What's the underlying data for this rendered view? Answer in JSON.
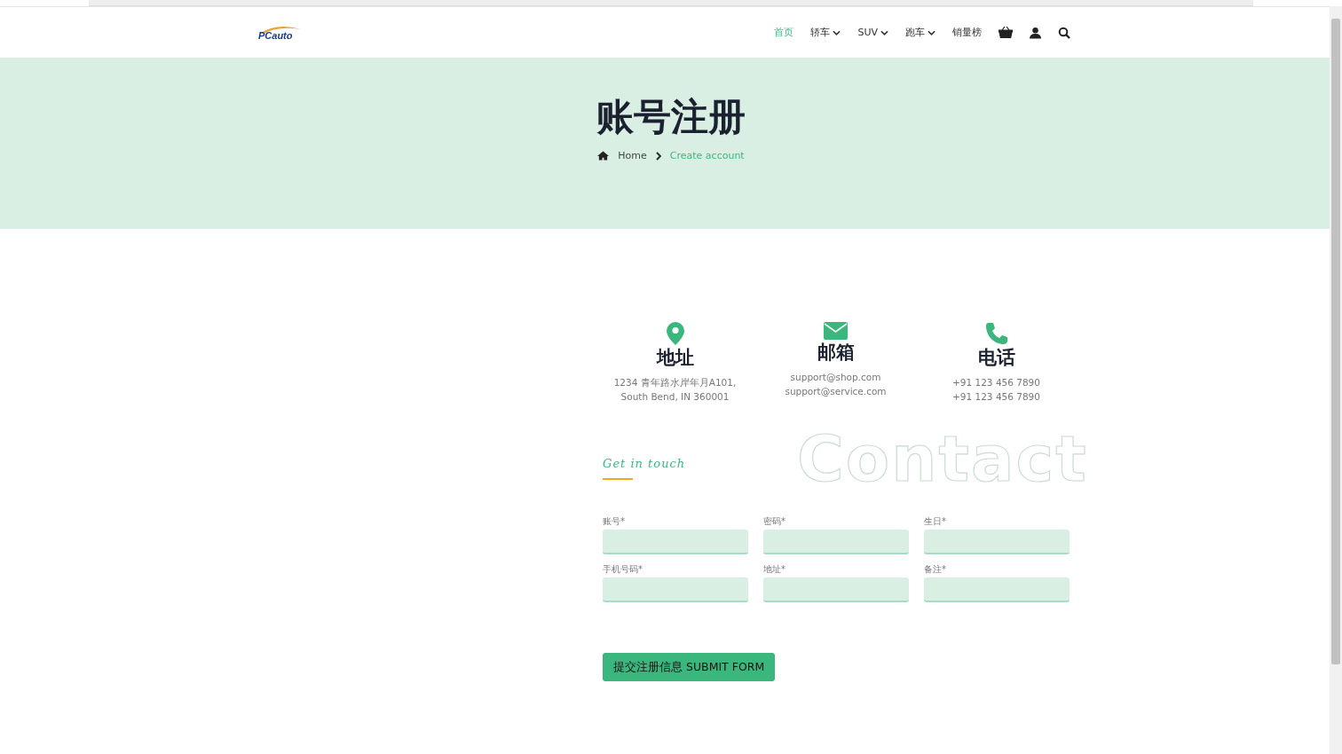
{
  "header": {
    "logo": "PCauto",
    "nav": [
      {
        "label": "首页",
        "selected": true,
        "dropdown": false
      },
      {
        "label": "轿车",
        "selected": false,
        "dropdown": true
      },
      {
        "label": "SUV",
        "selected": false,
        "dropdown": true
      },
      {
        "label": "跑车",
        "selected": false,
        "dropdown": true
      },
      {
        "label": "销量榜",
        "selected": false,
        "dropdown": false
      }
    ]
  },
  "hero": {
    "title": "账号注册",
    "breadcrumb": [
      {
        "label": "Home",
        "selected": false
      },
      {
        "label": "Create account",
        "selected": true
      }
    ]
  },
  "contact_info": [
    {
      "kind": "location",
      "title": "地址",
      "lines": [
        "1234 青年路水岸年月A101,",
        "South Bend, IN 360001"
      ]
    },
    {
      "kind": "mail",
      "title": "邮箱",
      "lines": [
        "support@shop.com",
        "support@service.com"
      ]
    },
    {
      "kind": "phone",
      "title": "电话",
      "lines": [
        "+91 123 456 7890",
        "+91 123 456 7890"
      ]
    }
  ],
  "form": {
    "tagline": "Get in touch",
    "backdrop": "Contact",
    "fields": [
      {
        "label": "账号*"
      },
      {
        "label": "密码*"
      },
      {
        "label": "生日*"
      },
      {
        "label": "手机号码*"
      },
      {
        "label": "地址*"
      },
      {
        "label": "备注*"
      }
    ],
    "submit": "提交注册信息 SUBMIT FORM"
  }
}
